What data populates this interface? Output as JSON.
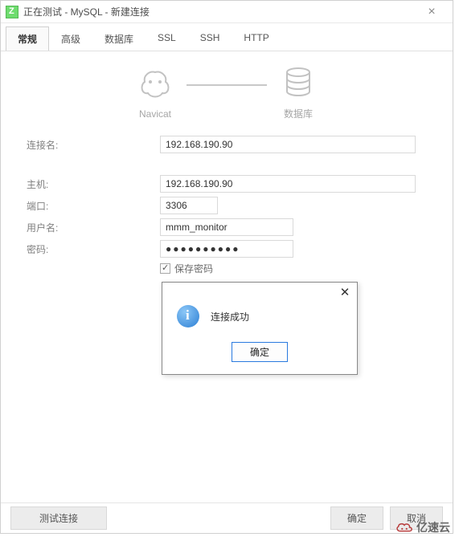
{
  "window": {
    "title": "正在测试 - MySQL - 新建连接"
  },
  "tabs": {
    "general": "常规",
    "advanced": "高级",
    "database": "数据库",
    "ssl": "SSL",
    "ssh": "SSH",
    "http": "HTTP",
    "active": "general"
  },
  "diagram": {
    "left_label": "Navicat",
    "right_label": "数据库"
  },
  "form": {
    "connection_name_label": "连接名:",
    "connection_name_value": "192.168.190.90",
    "host_label": "主机:",
    "host_value": "192.168.190.90",
    "port_label": "端口:",
    "port_value": "3306",
    "username_label": "用户名:",
    "username_value": "mmm_monitor",
    "password_label": "密码:",
    "password_value": "●●●●●●●●●●",
    "save_password_label": "保存密码",
    "save_password_checked": true
  },
  "msgbox": {
    "text": "连接成功",
    "ok": "确定"
  },
  "footer": {
    "test": "测试连接",
    "ok": "确定",
    "cancel": "取消"
  },
  "watermark": {
    "text": "亿速云"
  },
  "icons": {
    "app": "navicat-app-icon",
    "close": "close-icon",
    "navicat": "navicat-elephant-icon",
    "database": "database-cylinder-icon",
    "info": "info-icon",
    "msg_close": "close-icon",
    "cloud": "cloud-icon"
  }
}
